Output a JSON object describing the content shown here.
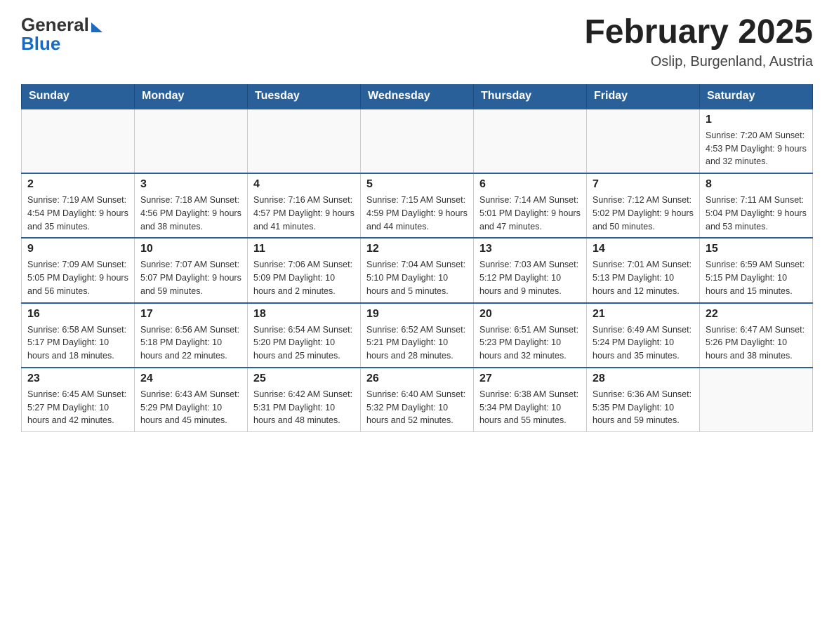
{
  "header": {
    "title": "February 2025",
    "location": "Oslip, Burgenland, Austria"
  },
  "days_of_week": [
    "Sunday",
    "Monday",
    "Tuesday",
    "Wednesday",
    "Thursday",
    "Friday",
    "Saturday"
  ],
  "weeks": [
    [
      {
        "day": "",
        "info": ""
      },
      {
        "day": "",
        "info": ""
      },
      {
        "day": "",
        "info": ""
      },
      {
        "day": "",
        "info": ""
      },
      {
        "day": "",
        "info": ""
      },
      {
        "day": "",
        "info": ""
      },
      {
        "day": "1",
        "info": "Sunrise: 7:20 AM\nSunset: 4:53 PM\nDaylight: 9 hours\nand 32 minutes."
      }
    ],
    [
      {
        "day": "2",
        "info": "Sunrise: 7:19 AM\nSunset: 4:54 PM\nDaylight: 9 hours\nand 35 minutes."
      },
      {
        "day": "3",
        "info": "Sunrise: 7:18 AM\nSunset: 4:56 PM\nDaylight: 9 hours\nand 38 minutes."
      },
      {
        "day": "4",
        "info": "Sunrise: 7:16 AM\nSunset: 4:57 PM\nDaylight: 9 hours\nand 41 minutes."
      },
      {
        "day": "5",
        "info": "Sunrise: 7:15 AM\nSunset: 4:59 PM\nDaylight: 9 hours\nand 44 minutes."
      },
      {
        "day": "6",
        "info": "Sunrise: 7:14 AM\nSunset: 5:01 PM\nDaylight: 9 hours\nand 47 minutes."
      },
      {
        "day": "7",
        "info": "Sunrise: 7:12 AM\nSunset: 5:02 PM\nDaylight: 9 hours\nand 50 minutes."
      },
      {
        "day": "8",
        "info": "Sunrise: 7:11 AM\nSunset: 5:04 PM\nDaylight: 9 hours\nand 53 minutes."
      }
    ],
    [
      {
        "day": "9",
        "info": "Sunrise: 7:09 AM\nSunset: 5:05 PM\nDaylight: 9 hours\nand 56 minutes."
      },
      {
        "day": "10",
        "info": "Sunrise: 7:07 AM\nSunset: 5:07 PM\nDaylight: 9 hours\nand 59 minutes."
      },
      {
        "day": "11",
        "info": "Sunrise: 7:06 AM\nSunset: 5:09 PM\nDaylight: 10 hours\nand 2 minutes."
      },
      {
        "day": "12",
        "info": "Sunrise: 7:04 AM\nSunset: 5:10 PM\nDaylight: 10 hours\nand 5 minutes."
      },
      {
        "day": "13",
        "info": "Sunrise: 7:03 AM\nSunset: 5:12 PM\nDaylight: 10 hours\nand 9 minutes."
      },
      {
        "day": "14",
        "info": "Sunrise: 7:01 AM\nSunset: 5:13 PM\nDaylight: 10 hours\nand 12 minutes."
      },
      {
        "day": "15",
        "info": "Sunrise: 6:59 AM\nSunset: 5:15 PM\nDaylight: 10 hours\nand 15 minutes."
      }
    ],
    [
      {
        "day": "16",
        "info": "Sunrise: 6:58 AM\nSunset: 5:17 PM\nDaylight: 10 hours\nand 18 minutes."
      },
      {
        "day": "17",
        "info": "Sunrise: 6:56 AM\nSunset: 5:18 PM\nDaylight: 10 hours\nand 22 minutes."
      },
      {
        "day": "18",
        "info": "Sunrise: 6:54 AM\nSunset: 5:20 PM\nDaylight: 10 hours\nand 25 minutes."
      },
      {
        "day": "19",
        "info": "Sunrise: 6:52 AM\nSunset: 5:21 PM\nDaylight: 10 hours\nand 28 minutes."
      },
      {
        "day": "20",
        "info": "Sunrise: 6:51 AM\nSunset: 5:23 PM\nDaylight: 10 hours\nand 32 minutes."
      },
      {
        "day": "21",
        "info": "Sunrise: 6:49 AM\nSunset: 5:24 PM\nDaylight: 10 hours\nand 35 minutes."
      },
      {
        "day": "22",
        "info": "Sunrise: 6:47 AM\nSunset: 5:26 PM\nDaylight: 10 hours\nand 38 minutes."
      }
    ],
    [
      {
        "day": "23",
        "info": "Sunrise: 6:45 AM\nSunset: 5:27 PM\nDaylight: 10 hours\nand 42 minutes."
      },
      {
        "day": "24",
        "info": "Sunrise: 6:43 AM\nSunset: 5:29 PM\nDaylight: 10 hours\nand 45 minutes."
      },
      {
        "day": "25",
        "info": "Sunrise: 6:42 AM\nSunset: 5:31 PM\nDaylight: 10 hours\nand 48 minutes."
      },
      {
        "day": "26",
        "info": "Sunrise: 6:40 AM\nSunset: 5:32 PM\nDaylight: 10 hours\nand 52 minutes."
      },
      {
        "day": "27",
        "info": "Sunrise: 6:38 AM\nSunset: 5:34 PM\nDaylight: 10 hours\nand 55 minutes."
      },
      {
        "day": "28",
        "info": "Sunrise: 6:36 AM\nSunset: 5:35 PM\nDaylight: 10 hours\nand 59 minutes."
      },
      {
        "day": "",
        "info": ""
      }
    ]
  ],
  "logo": {
    "general": "General",
    "blue": "Blue"
  }
}
